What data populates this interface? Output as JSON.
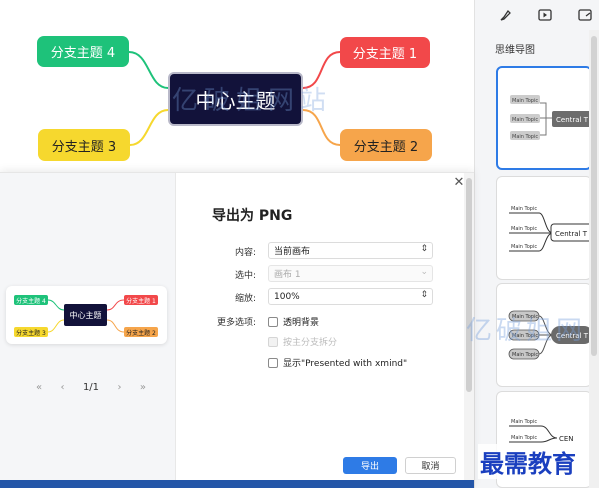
{
  "mindmap": {
    "central": "中心主题",
    "branches": [
      {
        "label": "分支主题 1",
        "color": "#f2484a"
      },
      {
        "label": "分支主题 2",
        "color": "#f6a54b"
      },
      {
        "label": "分支主题 3",
        "color": "#f6d82e"
      },
      {
        "label": "分支主题 4",
        "color": "#1ec27a"
      }
    ],
    "watermark": "亿破姐网站"
  },
  "right_panel": {
    "tabs": [
      {
        "icon": "brush-icon"
      },
      {
        "icon": "play-icon"
      },
      {
        "icon": "note-icon"
      }
    ],
    "section_title": "思维导图",
    "thumbnails": [
      {
        "central": "Central T",
        "topics": [
          "Main Topic",
          "Main Topic",
          "Main Topic"
        ],
        "selected": true
      },
      {
        "central": "Central T",
        "topics": [
          "Main Topic",
          "Main Topic",
          "Main Topic"
        ],
        "selected": false
      },
      {
        "central": "Central T",
        "topics": [
          "Main Topic",
          "Main Topic",
          "Main Topic"
        ],
        "selected": false
      },
      {
        "central": "CEN",
        "topics": [
          "Main Topic",
          "Main Topic"
        ],
        "selected": false
      }
    ]
  },
  "dialog": {
    "title": "导出为 PNG",
    "preview": {
      "central": "中心主题",
      "branches": [
        "分支主题 1",
        "分支主题 2",
        "分支主题 3",
        "分支主题 4"
      ]
    },
    "pager": {
      "first": "«",
      "prev": "‹",
      "count": "1/1",
      "next": "›",
      "last": "»"
    },
    "fields": {
      "content_label": "内容:",
      "content_value": "当前画布",
      "selected_label": "选中:",
      "selected_value": "画布 1",
      "zoom_label": "缩放:",
      "zoom_value": "100%",
      "options_label": "更多选项:"
    },
    "options": [
      {
        "label": "透明背景",
        "checked": false,
        "disabled": false
      },
      {
        "label": "按主分支拆分",
        "checked": false,
        "disabled": true
      },
      {
        "label": "显示\"Presented with xmind\"",
        "checked": false,
        "disabled": false
      }
    ],
    "buttons": {
      "export": "导出",
      "cancel": "取消"
    },
    "close_icon": "close-icon"
  },
  "watermarks": {
    "mid": "亿破姐网",
    "bottom": "最需教育"
  }
}
